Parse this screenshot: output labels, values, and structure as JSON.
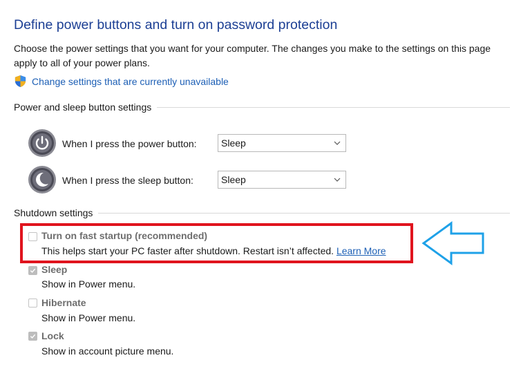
{
  "page": {
    "title": "Define power buttons and turn on password protection",
    "description": "Choose the power settings that you want for your computer. The changes you make to the settings on this page apply to all of your power plans.",
    "change_link": "Change settings that are currently unavailable"
  },
  "power_sleep": {
    "group_label": "Power and sleep button settings",
    "rows": [
      {
        "label": "When I press the power button:",
        "value": "Sleep",
        "icon": "power-button-icon"
      },
      {
        "label": "When I press the sleep button:",
        "value": "Sleep",
        "icon": "sleep-button-icon"
      }
    ]
  },
  "shutdown": {
    "group_label": "Shutdown settings",
    "options": [
      {
        "title": "Turn on fast startup (recommended)",
        "desc": "This helps start your PC faster after shutdown. Restart isn’t affected.",
        "link": "Learn More",
        "checked": false
      },
      {
        "title": "Sleep",
        "desc": "Show in Power menu.",
        "checked": true
      },
      {
        "title": "Hibernate",
        "desc": "Show in Power menu.",
        "checked": false
      },
      {
        "title": "Lock",
        "desc": "Show in account picture menu.",
        "checked": true
      }
    ]
  },
  "colors": {
    "title": "#1c3f94",
    "link": "#1d5fb5",
    "highlight_box": "#e0141e",
    "arrow": "#1ea1e8"
  }
}
